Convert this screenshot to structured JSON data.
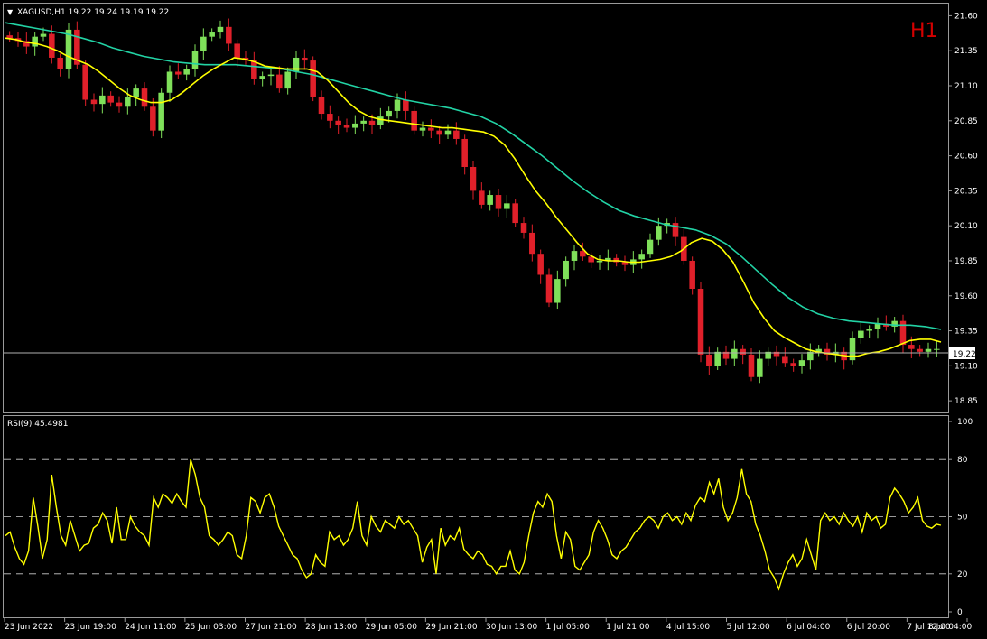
{
  "header": {
    "symbol_line": "XAGUSD,H1  19.22 19.24 19.19 19.22",
    "timeframe_badge": "H1"
  },
  "colors": {
    "background": "#000000",
    "bull": "#7fe05a",
    "bear": "#e0202a",
    "ma_fast": "#ffff00",
    "ma_slow": "#22d3a5",
    "rsi": "#ffff00",
    "grid_dash": "#cccccc",
    "badge": "#d40000"
  },
  "price_panel": {
    "y_ticks": [
      "21.60",
      "21.35",
      "21.10",
      "20.85",
      "20.60",
      "20.35",
      "20.10",
      "19.85",
      "19.60",
      "19.35",
      "19.10",
      "18.85"
    ],
    "current_price_label": "19.22"
  },
  "rsi_panel": {
    "label": "RSI(9) 45.4981",
    "y_ticks": [
      "100",
      "80",
      "50",
      "20",
      "0"
    ]
  },
  "x_axis": {
    "labels": [
      "23 Jun 2022",
      "23 Jun 19:00",
      "24 Jun 11:00",
      "25 Jun 03:00",
      "27 Jun 21:00",
      "28 Jun 13:00",
      "29 Jun 05:00",
      "29 Jun 21:00",
      "30 Jun 13:00",
      "1 Jul 05:00",
      "1 Jul 21:00",
      "4 Jul 15:00",
      "5 Jul 12:00",
      "6 Jul 04:00",
      "6 Jul 20:00",
      "7 Jul 12:00",
      "8 Jul 04:00"
    ]
  },
  "chart_data": [
    {
      "type": "candlestick",
      "title": "XAGUSD,H1",
      "ylim": [
        18.78,
        21.68
      ],
      "current_price": 19.22,
      "close_series": [
        21.44,
        21.42,
        21.38,
        21.45,
        21.47,
        21.3,
        21.22,
        21.5,
        21.25,
        21.0,
        20.97,
        21.03,
        20.98,
        20.95,
        21.02,
        21.08,
        20.95,
        20.78,
        21.05,
        21.2,
        21.18,
        21.22,
        21.35,
        21.45,
        21.48,
        21.52,
        21.4,
        21.3,
        21.28,
        21.15,
        21.17,
        21.18,
        21.08,
        21.2,
        21.3,
        21.28,
        21.02,
        20.9,
        20.85,
        20.82,
        20.8,
        20.83,
        20.85,
        20.82,
        20.88,
        20.92,
        21.0,
        20.92,
        20.78,
        20.8,
        20.78,
        20.75,
        20.78,
        20.72,
        20.52,
        20.35,
        20.25,
        20.32,
        20.22,
        20.26,
        20.12,
        20.05,
        19.9,
        19.75,
        19.55,
        19.72,
        19.85,
        19.92,
        19.88,
        19.84,
        19.85,
        19.87,
        19.84,
        19.82,
        19.86,
        19.9,
        20.0,
        20.1,
        20.12,
        20.02,
        19.85,
        19.65,
        19.18,
        19.1,
        19.2,
        19.15,
        19.22,
        19.18,
        19.02,
        19.15,
        19.2,
        19.17,
        19.12,
        19.1,
        19.14,
        19.2,
        19.22,
        19.18,
        19.2,
        19.14,
        19.3,
        19.35,
        19.36,
        19.4,
        19.38,
        19.42,
        19.25,
        19.22,
        19.2,
        19.22,
        19.22
      ],
      "ma_fast_period_unlabeled": true,
      "ma_fast": [
        21.44,
        21.43,
        21.41,
        21.4,
        21.38,
        21.35,
        21.31,
        21.28,
        21.25,
        21.2,
        21.14,
        21.08,
        21.03,
        21.0,
        20.98,
        20.98,
        21.0,
        21.05,
        21.11,
        21.17,
        21.22,
        21.26,
        21.3,
        21.29,
        21.27,
        21.24,
        21.23,
        21.22,
        21.22,
        21.22,
        21.2,
        21.14,
        21.06,
        20.98,
        20.92,
        20.88,
        20.86,
        20.85,
        20.84,
        20.83,
        20.82,
        20.81,
        20.8,
        20.8,
        20.79,
        20.78,
        20.77,
        20.74,
        20.68,
        20.58,
        20.46,
        20.35,
        20.26,
        20.16,
        20.07,
        19.98,
        19.9,
        19.86,
        19.85,
        19.85,
        19.84,
        19.84,
        19.85,
        19.86,
        19.88,
        19.92,
        19.98,
        20.01,
        19.99,
        19.93,
        19.84,
        19.7,
        19.55,
        19.44,
        19.35,
        19.3,
        19.26,
        19.22,
        19.2,
        19.19,
        19.18,
        19.17,
        19.17,
        19.19,
        19.2,
        19.22,
        19.25,
        19.28,
        19.29,
        19.29,
        19.27
      ],
      "ma_slow": [
        21.55,
        21.53,
        21.51,
        21.49,
        21.47,
        21.44,
        21.41,
        21.37,
        21.34,
        21.31,
        21.29,
        21.27,
        21.26,
        21.25,
        21.25,
        21.25,
        21.24,
        21.23,
        21.22,
        21.2,
        21.18,
        21.15,
        21.12,
        21.09,
        21.06,
        21.03,
        21.0,
        20.98,
        20.96,
        20.94,
        20.91,
        20.88,
        20.83,
        20.76,
        20.68,
        20.6,
        20.51,
        20.42,
        20.34,
        20.27,
        20.21,
        20.17,
        20.14,
        20.11,
        20.09,
        20.07,
        20.03,
        19.97,
        19.88,
        19.78,
        19.68,
        19.59,
        19.52,
        19.47,
        19.44,
        19.42,
        19.41,
        19.4,
        19.39,
        19.39,
        19.38,
        19.36
      ]
    },
    {
      "type": "line",
      "title": "RSI(9) 45.4981",
      "ylim": [
        0,
        100
      ],
      "levels": [
        80,
        50,
        20
      ],
      "values": [
        40,
        42,
        34,
        28,
        25,
        32,
        60,
        45,
        28,
        38,
        72,
        55,
        40,
        35,
        48,
        40,
        32,
        35,
        36,
        44,
        46,
        52,
        48,
        36,
        55,
        38,
        38,
        50,
        45,
        42,
        40,
        35,
        60,
        55,
        62,
        60,
        57,
        62,
        58,
        55,
        80,
        72,
        60,
        55,
        40,
        38,
        35,
        38,
        42,
        40,
        30,
        28,
        40,
        60,
        58,
        52,
        60,
        62,
        55,
        45,
        40,
        35,
        30,
        28,
        22,
        18,
        20,
        30,
        26,
        24,
        42,
        38,
        40,
        35,
        38,
        44,
        58,
        40,
        35,
        50,
        45,
        42,
        48,
        46,
        44,
        50,
        46,
        48,
        44,
        40,
        26,
        34,
        38,
        20,
        44,
        35,
        40,
        38,
        44,
        33,
        30,
        28,
        32,
        30,
        25,
        24,
        20,
        24,
        24,
        32,
        22,
        20,
        26,
        40,
        52,
        58,
        55,
        62,
        58,
        40,
        28,
        42,
        38,
        24,
        22,
        26,
        30,
        42,
        48,
        44,
        38,
        30,
        28,
        32,
        34,
        38,
        42,
        44,
        48,
        50,
        48,
        44,
        50,
        52,
        48,
        50,
        46,
        52,
        48,
        56,
        60,
        58,
        68,
        62,
        70,
        55,
        48,
        52,
        60,
        75,
        62,
        58,
        46,
        40,
        32,
        22,
        18,
        12,
        20,
        26,
        30,
        24,
        28,
        38,
        30,
        22,
        48,
        52,
        48,
        50,
        46,
        52,
        48,
        45,
        50,
        42,
        52,
        48,
        50,
        44,
        46,
        60,
        65,
        62,
        58,
        52,
        55,
        60,
        48,
        45,
        44,
        46,
        45.5
      ]
    }
  ]
}
